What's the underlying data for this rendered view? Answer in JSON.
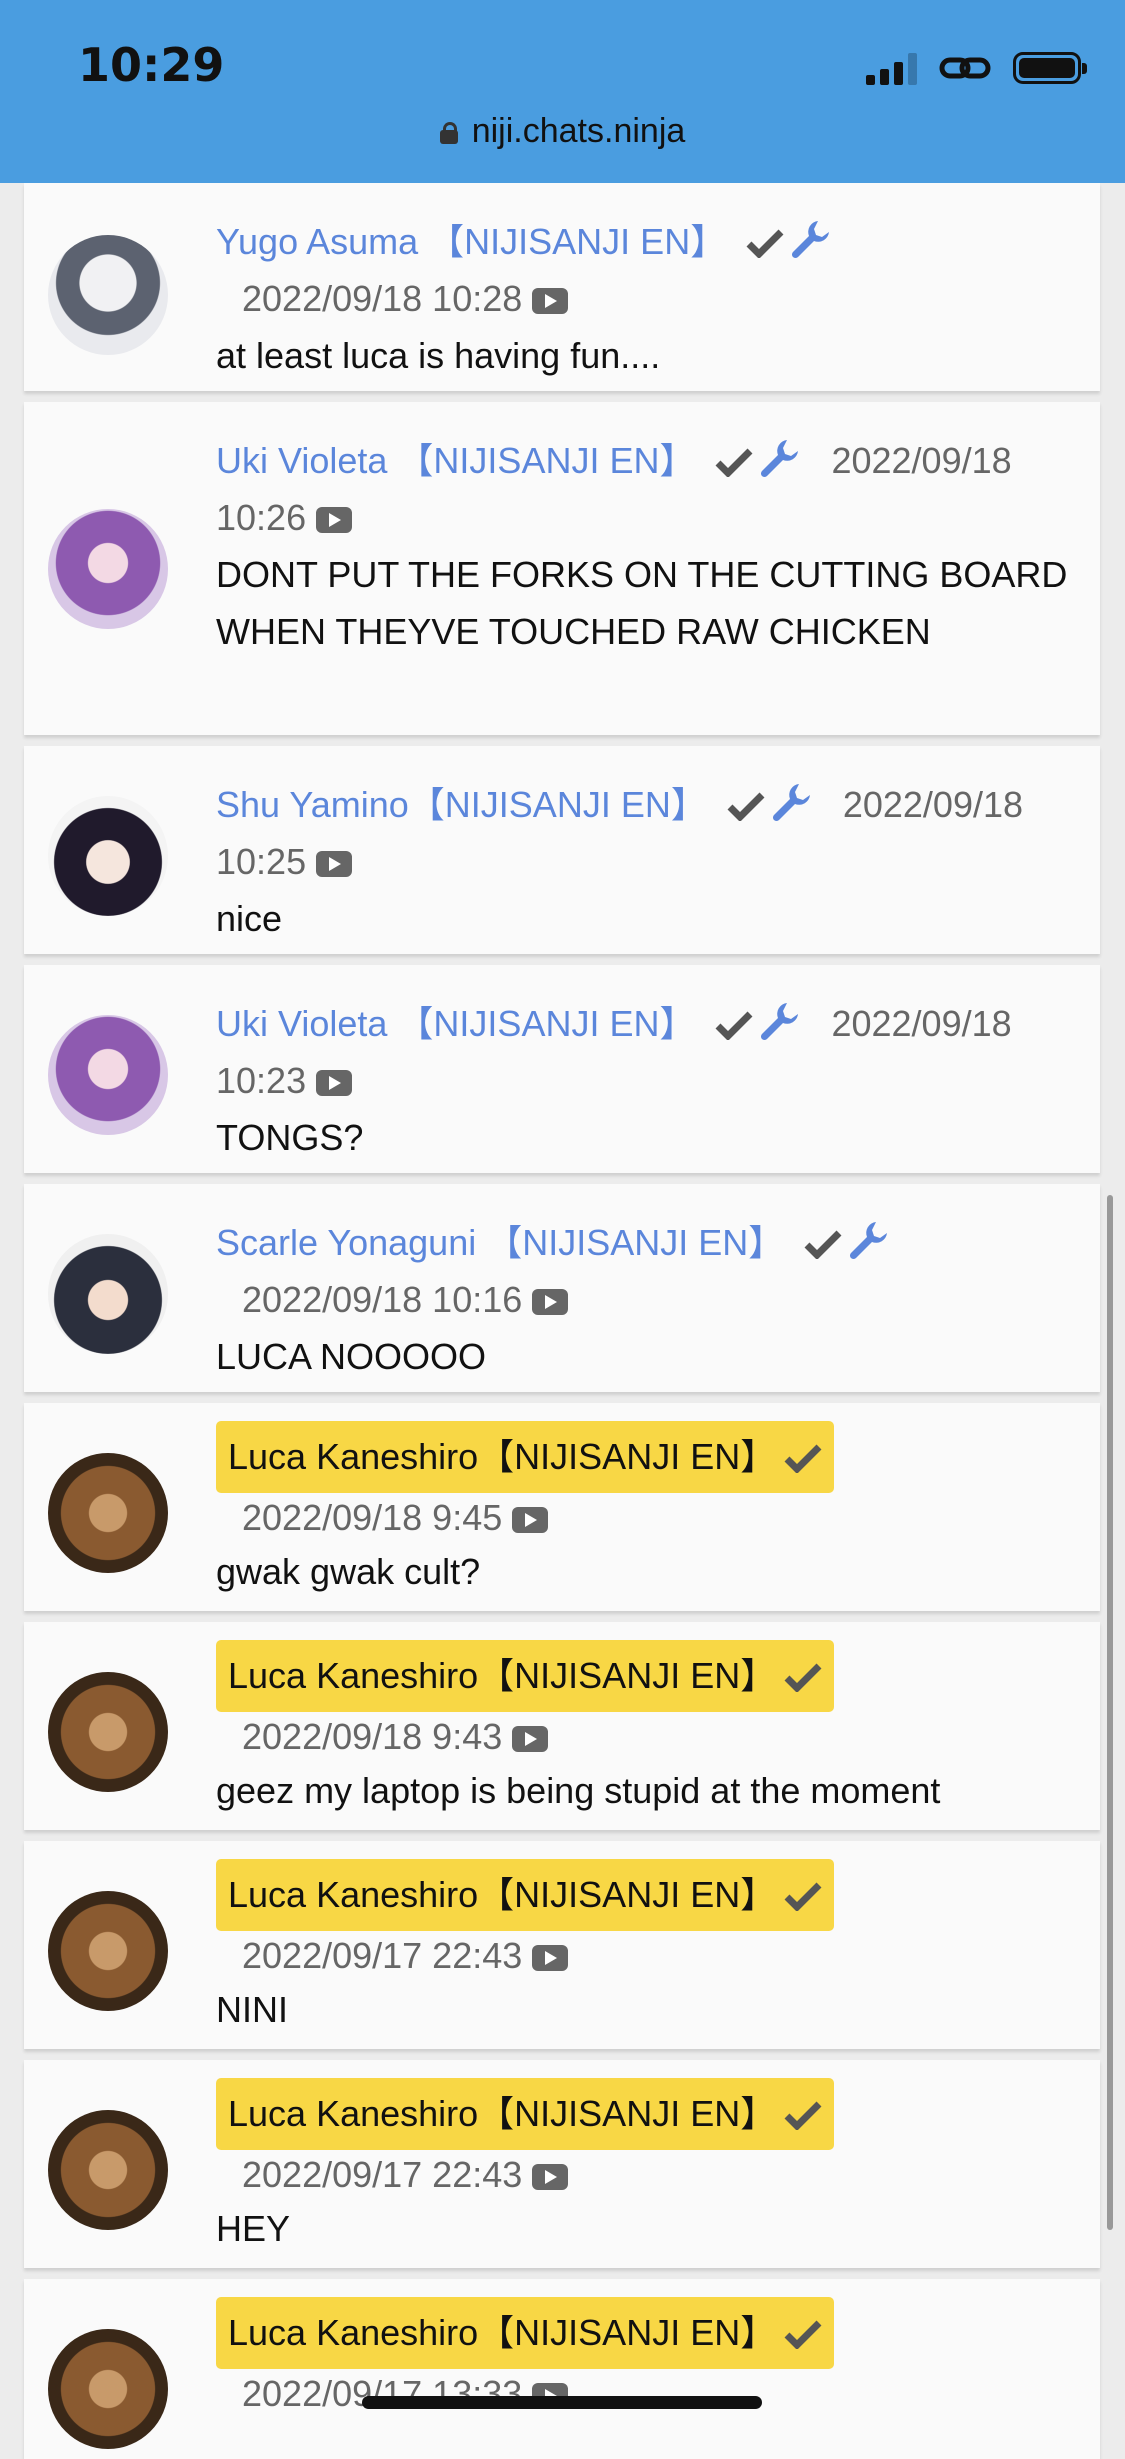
{
  "status_bar": {
    "time": "10:29"
  },
  "browser": {
    "url": "niji.chats.ninja"
  },
  "colors": {
    "name": "#5b86db",
    "highlight": "#f8d745",
    "header": "#4a9de0"
  },
  "messages": [
    {
      "name": "Yugo Asuma 【NIJISANJI EN】",
      "timestamp": "2022/09/18 10:28",
      "text": "at least luca is having fun....",
      "verified": true,
      "moderator": true,
      "highlight": false
    },
    {
      "name": "Uki Violeta 【NIJISANJI EN】",
      "timestamp": "2022/09/18 10:26",
      "text": "DONT PUT THE FORKS ON THE CUTTING BOARD WHEN THEYVE TOUCHED RAW CHICKEN",
      "verified": true,
      "moderator": true,
      "highlight": false
    },
    {
      "name": "Shu Yamino【NIJISANJI EN】",
      "timestamp": "2022/09/18 10:25",
      "text": "nice",
      "verified": true,
      "moderator": true,
      "highlight": false
    },
    {
      "name": "Uki Violeta 【NIJISANJI EN】",
      "timestamp": "2022/09/18 10:23",
      "text": "TONGS?",
      "verified": true,
      "moderator": true,
      "highlight": false
    },
    {
      "name": "Scarle Yonaguni 【NIJISANJI EN】",
      "timestamp": "2022/09/18 10:16",
      "text": "LUCA NOOOOO",
      "verified": true,
      "moderator": true,
      "highlight": false
    },
    {
      "name": "Luca Kaneshiro【NIJISANJI EN】",
      "timestamp": "2022/09/18 9:45",
      "text": "gwak gwak cult?",
      "verified": true,
      "moderator": false,
      "highlight": true
    },
    {
      "name": "Luca Kaneshiro【NIJISANJI EN】",
      "timestamp": "2022/09/18 9:43",
      "text": "geez my laptop is being stupid at the moment",
      "verified": true,
      "moderator": false,
      "highlight": true
    },
    {
      "name": "Luca Kaneshiro【NIJISANJI EN】",
      "timestamp": "2022/09/17 22:43",
      "text": "NINI",
      "verified": true,
      "moderator": false,
      "highlight": true
    },
    {
      "name": "Luca Kaneshiro【NIJISANJI EN】",
      "timestamp": "2022/09/17 22:43",
      "text": "HEY",
      "verified": true,
      "moderator": false,
      "highlight": true
    },
    {
      "name": "Luca Kaneshiro【NIJISANJI EN】",
      "timestamp": "2022/09/17 13:33",
      "text": "",
      "verified": true,
      "moderator": false,
      "highlight": true
    }
  ]
}
